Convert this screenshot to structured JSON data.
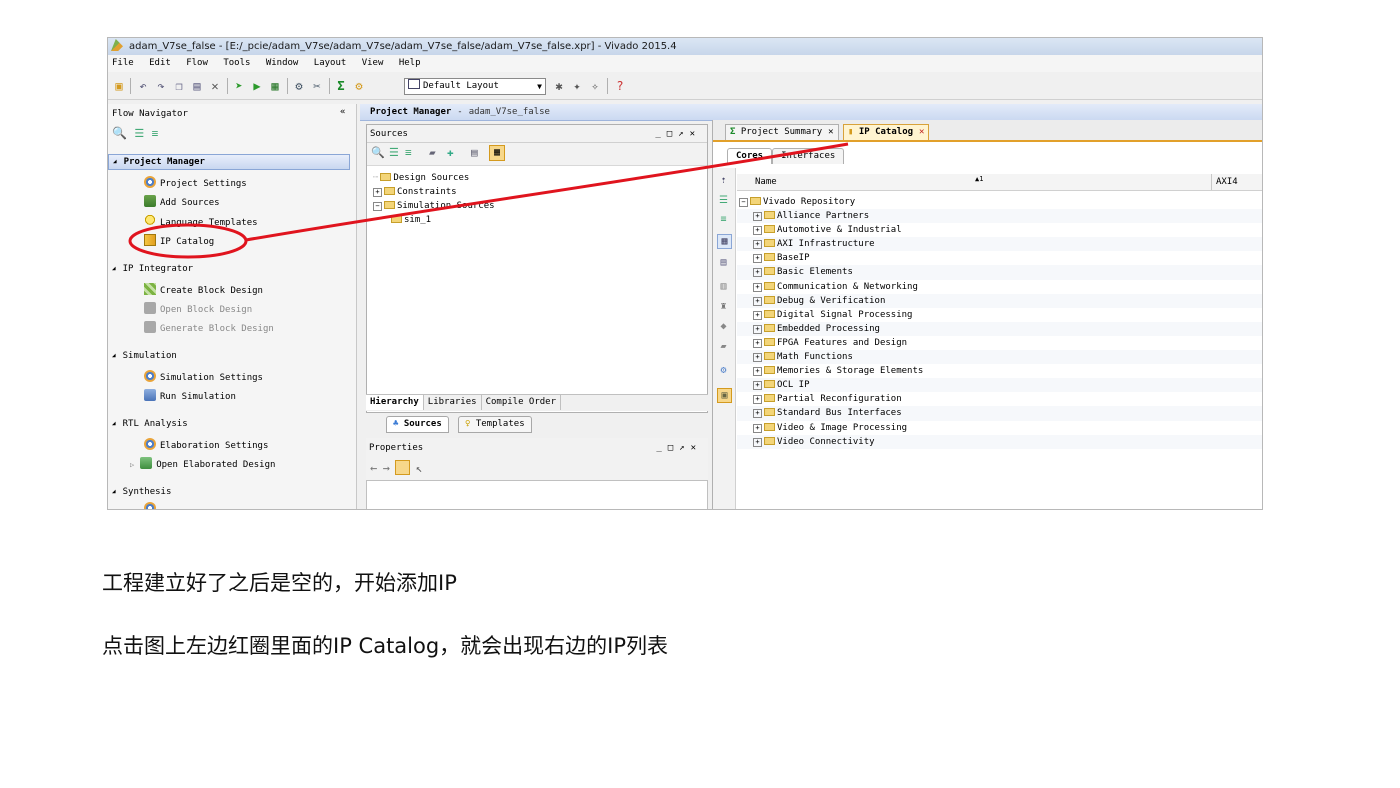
{
  "window": {
    "title": "adam_V7se_false - [E:/_pcie/adam_V7se/adam_V7se/adam_V7se_false/adam_V7se_false.xpr] - Vivado 2015.4"
  },
  "menu": [
    "File",
    "Edit",
    "Flow",
    "Tools",
    "Window",
    "Layout",
    "View",
    "Help"
  ],
  "toolbar": {
    "layout_select": "Default Layout"
  },
  "flow_navigator": {
    "title": "Flow Navigator",
    "collapse": "«",
    "sections": [
      {
        "label": "Project Manager",
        "items": [
          "Project Settings",
          "Add Sources",
          "Language Templates",
          "IP Catalog"
        ]
      },
      {
        "label": "IP Integrator",
        "items": [
          "Create Block Design",
          "Open Block Design",
          "Generate Block Design"
        ]
      },
      {
        "label": "Simulation",
        "items": [
          "Simulation Settings",
          "Run Simulation"
        ]
      },
      {
        "label": "RTL Analysis",
        "items": [
          "Elaboration Settings",
          "Open Elaborated Design"
        ]
      },
      {
        "label": "Synthesis",
        "items": []
      }
    ]
  },
  "project_manager": {
    "title": "Project Manager",
    "project_name": "adam_V7se_false"
  },
  "sources_panel": {
    "title": "Sources",
    "tree": [
      "Design Sources",
      "Constraints",
      "Simulation Sources",
      "sim_1"
    ],
    "tabs": [
      "Hierarchy",
      "Libraries",
      "Compile Order"
    ],
    "subtabs": [
      "Sources",
      "Templates"
    ]
  },
  "properties_panel": {
    "title": "Properties"
  },
  "ip_catalog": {
    "tabs": [
      "Project Summary",
      "IP Catalog"
    ],
    "inner_tabs": [
      "Cores",
      "Interfaces"
    ],
    "columns": [
      "Name",
      "AXI4"
    ],
    "sort_indicator": "1",
    "root": "Vivado Repository",
    "categories": [
      "Alliance Partners",
      "Automotive & Industrial",
      "AXI Infrastructure",
      "BaseIP",
      "Basic Elements",
      "Communication & Networking",
      "Debug & Verification",
      "Digital Signal Processing",
      "Embedded Processing",
      "FPGA Features and Design",
      "Math Functions",
      "Memories & Storage Elements",
      "OCL IP",
      "Partial Reconfiguration",
      "Standard Bus Interfaces",
      "Video & Image Processing",
      "Video Connectivity"
    ]
  },
  "captions": [
    "工程建立好了之后是空的，开始添加IP",
    "点击图上左边红圈里面的IP Catalog，就会出现右边的IP列表"
  ],
  "colors": {
    "annotation": "#e0141e",
    "highlight": "#c9d7f0",
    "active_tab": "#e2a02a"
  }
}
